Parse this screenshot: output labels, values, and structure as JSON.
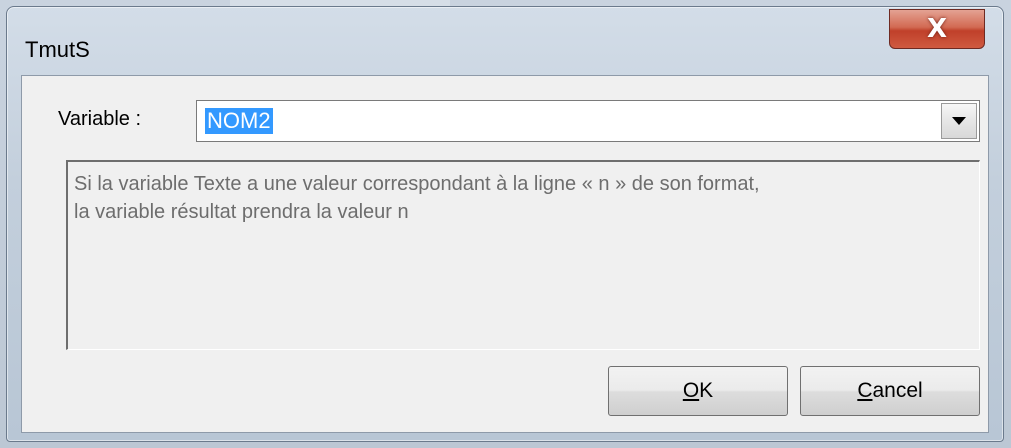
{
  "window": {
    "title": "TmutS",
    "close_glyph": "X"
  },
  "variable": {
    "label": "Variable :",
    "selected_value": "NOM2"
  },
  "description": {
    "line1": "Si la variable Texte a une valeur correspondant à la ligne « n » de son format,",
    "line2": "la variable résultat prendra la valeur n"
  },
  "buttons": {
    "ok": {
      "mnemonic": "O",
      "rest": "K"
    },
    "cancel": {
      "mnemonic": "C",
      "rest": "ancel"
    }
  },
  "colors": {
    "selection_highlight": "#3399ff",
    "close_button": "#c0402a",
    "description_text": "#6d6d6d"
  },
  "icons": {
    "close": "close-icon",
    "dropdown": "chevron-down-icon"
  }
}
